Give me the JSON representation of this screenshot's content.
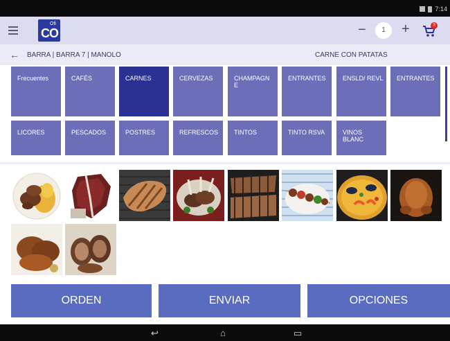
{
  "status_bar": {
    "time": "7:14"
  },
  "app_bar": {
    "logo_small": "Ofi",
    "logo_big": "CO",
    "minus_label": "−",
    "quantity": "1",
    "plus_label": "+",
    "cart_badge": "3"
  },
  "breadcrumb": {
    "path": "BARRA | BARRA 7 | MANOLO",
    "order_title": "CARNE CON PATATAS"
  },
  "categories": [
    {
      "label": "Frecuentes",
      "active": false
    },
    {
      "label": "CAFÉS",
      "active": false
    },
    {
      "label": "CARNES",
      "active": true
    },
    {
      "label": "CERVEZAS",
      "active": false
    },
    {
      "label": "CHAMPAGN E",
      "active": false
    },
    {
      "label": "ENTRANTES",
      "active": false
    },
    {
      "label": "ENSLD/ REVL",
      "active": false
    },
    {
      "label": "ENTRANTES",
      "active": false
    },
    {
      "label": "LICORES",
      "active": false
    },
    {
      "label": "PESCADOS",
      "active": false
    },
    {
      "label": "POSTRES",
      "active": false
    },
    {
      "label": "REFRESCOS",
      "active": false
    },
    {
      "label": "TINTOS",
      "active": false
    },
    {
      "label": "TINTO RSVA",
      "active": false
    },
    {
      "label": "VINOS BLANC",
      "active": false
    }
  ],
  "product_photos": [
    "sirloin-with-potatoes-photo",
    "t-bone-raw-photo",
    "grilled-steak-photo",
    "lamb-chops-photo",
    "grilled-chops-photo",
    "meat-skewers-photo",
    "paella-photo",
    "roast-chicken-photo",
    "roast-quail-photo",
    "rolled-meat-photo"
  ],
  "actions": {
    "orden": "ORDEN",
    "enviar": "ENVIAR",
    "opciones": "OPCIONES"
  },
  "colors": {
    "accent": "#2b3191",
    "category": "#6c6fb8",
    "button": "#5a6cc0",
    "app_bar": "#dcdcf0",
    "badge": "#e02525"
  }
}
